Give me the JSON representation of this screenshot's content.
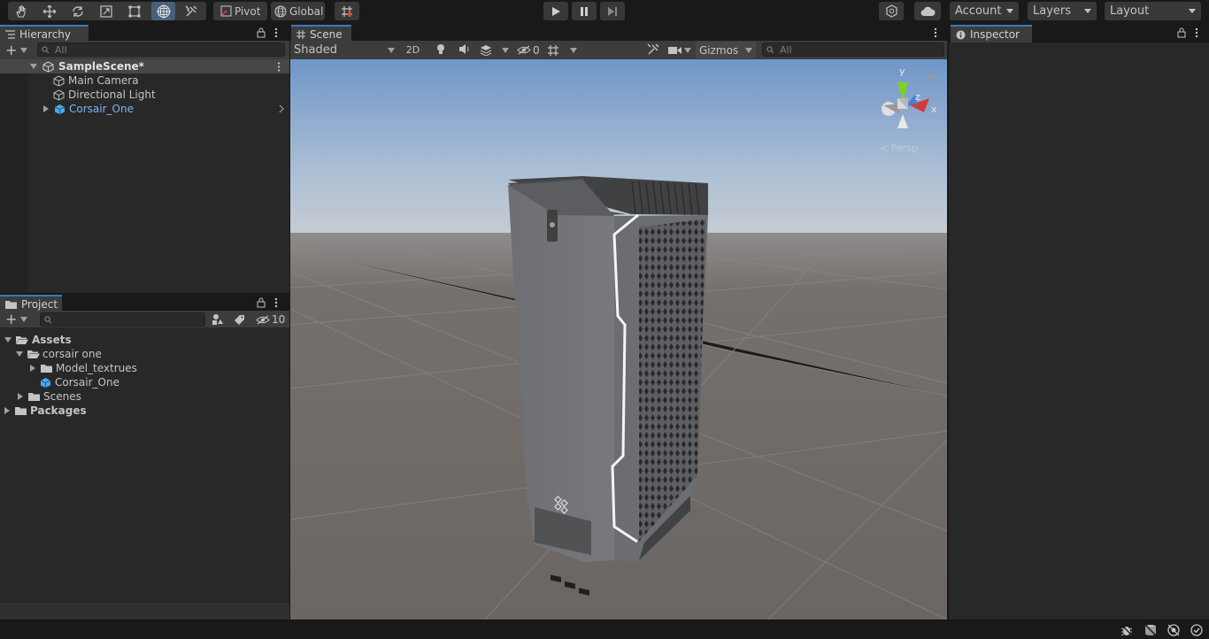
{
  "toolbar": {
    "tools": [
      "hand-tool-icon",
      "move-tool-icon",
      "rotate-tool-icon",
      "scale-tool-icon",
      "rect-tool-icon",
      "transform-tool-icon",
      "custom-tool-icon"
    ],
    "pivot_label": "Pivot",
    "global_label": "Global",
    "account_label": "Account",
    "layers_label": "Layers",
    "layout_label": "Layout"
  },
  "hierarchy": {
    "tab_label": "Hierarchy",
    "search_placeholder": "All",
    "scene_name": "SampleScene*",
    "items": [
      {
        "label": "Main Camera",
        "icon": "gameobject-icon"
      },
      {
        "label": "Directional Light",
        "icon": "gameobject-icon"
      },
      {
        "label": "Corsair_One",
        "icon": "prefab-icon",
        "color": "#7bb5f0"
      }
    ]
  },
  "project": {
    "tab_label": "Project",
    "hidden_count": "10",
    "tree": [
      {
        "label": "Assets",
        "bold": true
      },
      {
        "label": "corsair one"
      },
      {
        "label": "Model_textrues"
      },
      {
        "label": "Corsair_One"
      },
      {
        "label": "Scenes"
      },
      {
        "label": "Packages",
        "bold": true
      }
    ]
  },
  "scene": {
    "tab_label": "Scene",
    "shading_mode": "Shaded",
    "mode_2d": "2D",
    "hidden_objects": "0",
    "gizmos_label": "Gizmos",
    "search_placeholder": "All",
    "gizmo_axes": {
      "x": "x",
      "y": "y",
      "z": "z"
    },
    "perspective_label": "< Persp",
    "sky_color": "#6f96c9",
    "ground_color": "#6b6663"
  },
  "inspector": {
    "tab_label": "Inspector"
  },
  "colors": {
    "accent": "#3a79bb",
    "active_tool": "#46607c",
    "panel_bg": "#282828",
    "prefab_blue": "#7bb5f0"
  }
}
